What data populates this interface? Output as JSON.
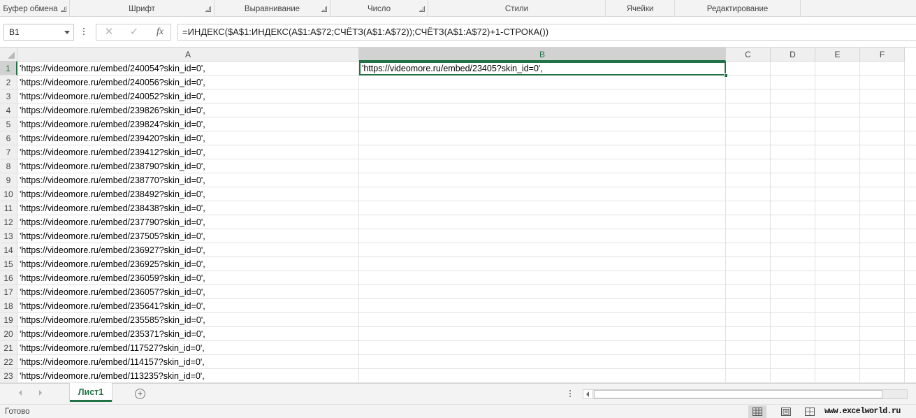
{
  "ribbon": {
    "groups": [
      {
        "label": "Буфер обмена"
      },
      {
        "label": "Шрифт"
      },
      {
        "label": "Выравнивание"
      },
      {
        "label": "Число"
      },
      {
        "label": "Стили"
      },
      {
        "label": "Ячейки"
      },
      {
        "label": "Редактирование"
      }
    ]
  },
  "formula_bar": {
    "name_box": "B1",
    "cancel_icon": "✕",
    "enter_icon": "✓",
    "fx_label": "fx",
    "formula": "=ИНДЕКС($A$1:ИНДЕКС(A$1:A$72;СЧЁТЗ(A$1:A$72));СЧЁТЗ(A$1:A$72)+1-СТРОКА())"
  },
  "grid": {
    "columns": [
      "A",
      "B",
      "C",
      "D",
      "E",
      "F"
    ],
    "active_column": "B",
    "active_row": "1",
    "rows": [
      {
        "num": "1",
        "a": "'https://videomore.ru/embed/240054?skin_id=0',"
      },
      {
        "num": "2",
        "a": "'https://videomore.ru/embed/240056?skin_id=0',"
      },
      {
        "num": "3",
        "a": "'https://videomore.ru/embed/240052?skin_id=0',"
      },
      {
        "num": "4",
        "a": "'https://videomore.ru/embed/239826?skin_id=0',"
      },
      {
        "num": "5",
        "a": "'https://videomore.ru/embed/239824?skin_id=0',"
      },
      {
        "num": "6",
        "a": "'https://videomore.ru/embed/239420?skin_id=0',"
      },
      {
        "num": "7",
        "a": "'https://videomore.ru/embed/239412?skin_id=0',"
      },
      {
        "num": "8",
        "a": "'https://videomore.ru/embed/238790?skin_id=0',"
      },
      {
        "num": "9",
        "a": "'https://videomore.ru/embed/238770?skin_id=0',"
      },
      {
        "num": "10",
        "a": "'https://videomore.ru/embed/238492?skin_id=0',"
      },
      {
        "num": "11",
        "a": "'https://videomore.ru/embed/238438?skin_id=0',"
      },
      {
        "num": "12",
        "a": "'https://videomore.ru/embed/237790?skin_id=0',"
      },
      {
        "num": "13",
        "a": "'https://videomore.ru/embed/237505?skin_id=0',"
      },
      {
        "num": "14",
        "a": "'https://videomore.ru/embed/236927?skin_id=0',"
      },
      {
        "num": "15",
        "a": "'https://videomore.ru/embed/236925?skin_id=0',"
      },
      {
        "num": "16",
        "a": "'https://videomore.ru/embed/236059?skin_id=0',"
      },
      {
        "num": "17",
        "a": "'https://videomore.ru/embed/236057?skin_id=0',"
      },
      {
        "num": "18",
        "a": "'https://videomore.ru/embed/235641?skin_id=0',"
      },
      {
        "num": "19",
        "a": "'https://videomore.ru/embed/235585?skin_id=0',"
      },
      {
        "num": "20",
        "a": "'https://videomore.ru/embed/235371?skin_id=0',"
      },
      {
        "num": "21",
        "a": "'https://videomore.ru/embed/117527?skin_id=0',"
      },
      {
        "num": "22",
        "a": "'https://videomore.ru/embed/114157?skin_id=0',"
      },
      {
        "num": "23",
        "a": "'https://videomore.ru/embed/113235?skin_id=0',"
      }
    ],
    "b1_value": "'https://videomore.ru/embed/23405?skin_id=0',"
  },
  "sheet_tabs": {
    "active": "Лист1",
    "add_icon": "+"
  },
  "status": {
    "text": "Готово",
    "watermark": "www.excelworld.ru"
  },
  "colors": {
    "accent": "#217346",
    "header_bg": "#efefef",
    "gridline": "#e1e1e1"
  }
}
